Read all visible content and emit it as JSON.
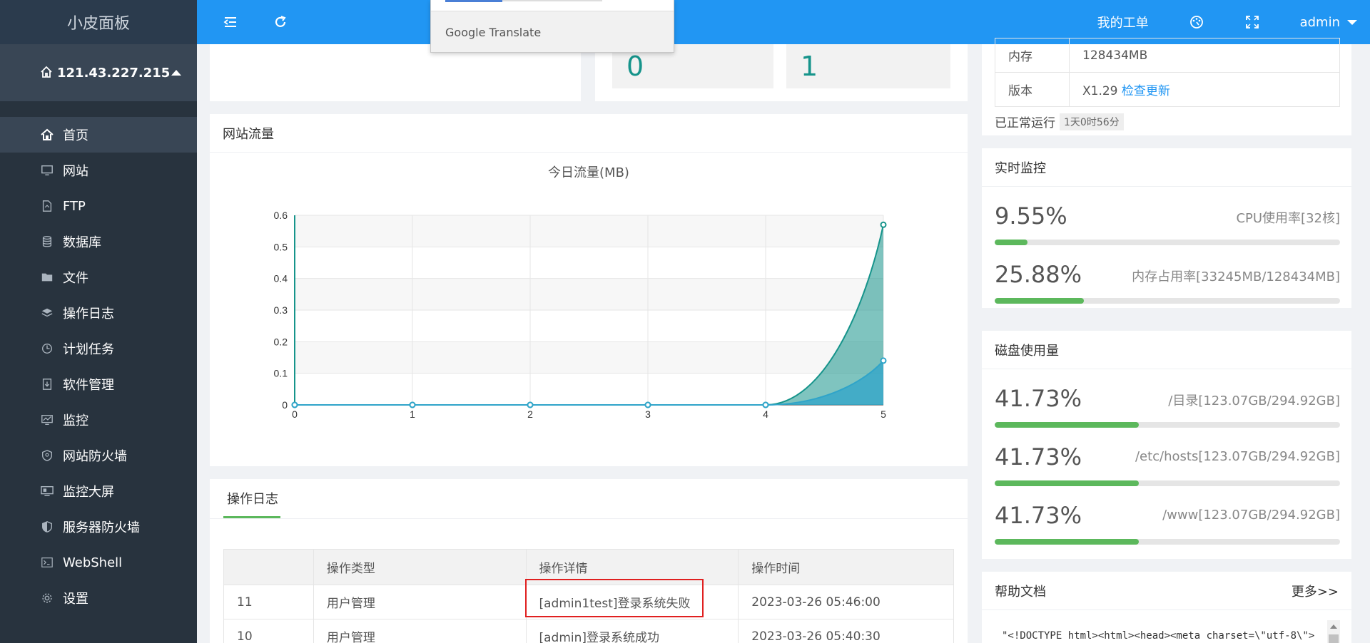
{
  "sidebar": {
    "logo": "小皮面板",
    "server_ip": "121.43.227.215",
    "items": [
      {
        "label": "首页",
        "icon": "home-icon",
        "active": true
      },
      {
        "label": "网站",
        "icon": "monitor-icon"
      },
      {
        "label": "FTP",
        "icon": "ftp-icon"
      },
      {
        "label": "数据库",
        "icon": "database-icon"
      },
      {
        "label": "文件",
        "icon": "folder-icon"
      },
      {
        "label": "操作日志",
        "icon": "layers-icon"
      },
      {
        "label": "计划任务",
        "icon": "clock-icon"
      },
      {
        "label": "软件管理",
        "icon": "download-box-icon"
      },
      {
        "label": "监控",
        "icon": "chart-monitor-icon"
      },
      {
        "label": "网站防火墙",
        "icon": "shield-icon"
      },
      {
        "label": "监控大屏",
        "icon": "screen-icon"
      },
      {
        "label": "服务器防火墙",
        "icon": "shield-half-icon"
      },
      {
        "label": "WebShell",
        "icon": "terminal-icon"
      },
      {
        "label": "设置",
        "icon": "gear-icon"
      }
    ]
  },
  "topbar": {
    "my_tickets": "我的工单",
    "user": "admin"
  },
  "translate_popup": {
    "brand": "Google Translate"
  },
  "stats": {
    "tile1_value": "0",
    "tile2_value": "1"
  },
  "system_info": {
    "rows": [
      {
        "key": "内存",
        "value": "128434MB"
      },
      {
        "key": "版本",
        "value": "X1.29",
        "link": "检查更新"
      }
    ],
    "uptime_label": "已正常运行",
    "uptime_value": "1天0时56分"
  },
  "realtime": {
    "title": "实时监控",
    "cpu_value": "9.55%",
    "cpu_label": "CPU使用率[32核]",
    "cpu_pct": 9.55,
    "mem_value": "25.88%",
    "mem_label": "内存占用率[33245MB/128434MB]",
    "mem_pct": 25.88
  },
  "disk": {
    "title": "磁盘使用量",
    "rows": [
      {
        "value": "41.73%",
        "label": "/目录[123.07GB/294.92GB]",
        "pct": 41.73
      },
      {
        "value": "41.73%",
        "label": "/etc/hosts[123.07GB/294.92GB]",
        "pct": 41.73
      },
      {
        "value": "41.73%",
        "label": "/www[123.07GB/294.92GB]",
        "pct": 41.73
      }
    ]
  },
  "help": {
    "title": "帮助文档",
    "more": "更多>>",
    "code": "\"<!DOCTYPE html><html><head><meta charset=\\\"utf-8\\\">"
  },
  "traffic": {
    "card_title": "网站流量"
  },
  "chart_data": {
    "type": "area",
    "title": "今日流量(MB)",
    "x": [
      0,
      1,
      2,
      3,
      4,
      5
    ],
    "ylim": [
      0,
      0.6
    ],
    "yticks": [
      0,
      0.1,
      0.2,
      0.3,
      0.4,
      0.5,
      0.6
    ],
    "grid": true,
    "series": [
      {
        "values": [
          0,
          0,
          0,
          0,
          0,
          0.57
        ],
        "color": "#16948b"
      },
      {
        "values": [
          0,
          0,
          0,
          0,
          0,
          0.14
        ],
        "color": "#2fa4c9"
      }
    ]
  },
  "oplog": {
    "tab": "操作日志",
    "headers": [
      "",
      "操作类型",
      "操作详情",
      "操作时间"
    ],
    "rows": [
      [
        "11",
        "用户管理",
        "[admin1test]登录系统失败",
        "2023-03-26 05:46:00"
      ],
      [
        "10",
        "用户管理",
        "[admin]登录系统成功",
        "2023-03-26 05:40:30"
      ]
    ]
  },
  "colors": {
    "accent": "#2196f3",
    "sidebar": "#28333e",
    "progress": "#5cb85c",
    "teal": "#16948b"
  }
}
